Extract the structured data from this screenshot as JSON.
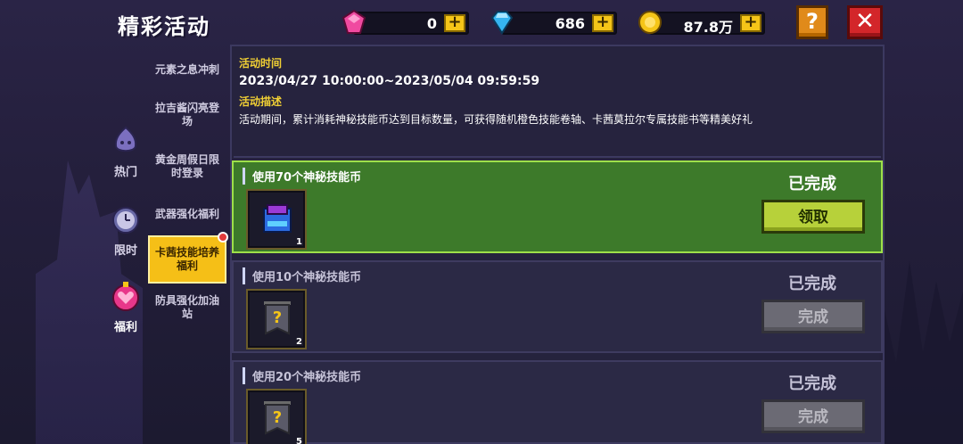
{
  "header": {
    "title": "精彩活动",
    "currencies": [
      {
        "icon": "pink-gem-icon",
        "value": "0"
      },
      {
        "icon": "blue-diamond-icon",
        "value": "686"
      },
      {
        "icon": "gold-coin-icon",
        "value": "87.8万"
      }
    ],
    "plus_label": "+",
    "help_label": "?",
    "close_label": "✕"
  },
  "categories": [
    {
      "label": "热门",
      "icon": "purple-blob-icon"
    },
    {
      "label": "限时",
      "icon": "clock-icon"
    },
    {
      "label": "福利",
      "icon": "gift-heart-icon"
    }
  ],
  "submenu": [
    {
      "label": "元素之息冲刺"
    },
    {
      "label": "拉吉酱闪亮登场"
    },
    {
      "label": "黄金周假日限时登录"
    },
    {
      "label": "武器强化福利"
    },
    {
      "label": "卡茜技能培养福利"
    },
    {
      "label": "防具强化加油站"
    }
  ],
  "info": {
    "time_label": "活动时间",
    "time_value": "2023/04/27 10:00:00~2023/05/04 09:59:59",
    "desc_label": "活动描述",
    "desc_value": "活动期间，累计消耗神秘技能币达到目标数量，可获得随机橙色技能卷轴、卡茜莫拉尔专属技能书等精美好礼"
  },
  "tasks": [
    {
      "title": "使用70个神秘技能币",
      "status": "已完成",
      "button": "领取",
      "qty": "1",
      "item_icon": "skill-book-icon"
    },
    {
      "title": "使用10个神秘技能币",
      "status": "已完成",
      "button": "完成",
      "qty": "2",
      "item_icon": "mystery-banner-icon"
    },
    {
      "title": "使用20个神秘技能币",
      "status": "已完成",
      "button": "完成",
      "qty": "5",
      "item_icon": "mystery-banner-icon"
    }
  ]
}
